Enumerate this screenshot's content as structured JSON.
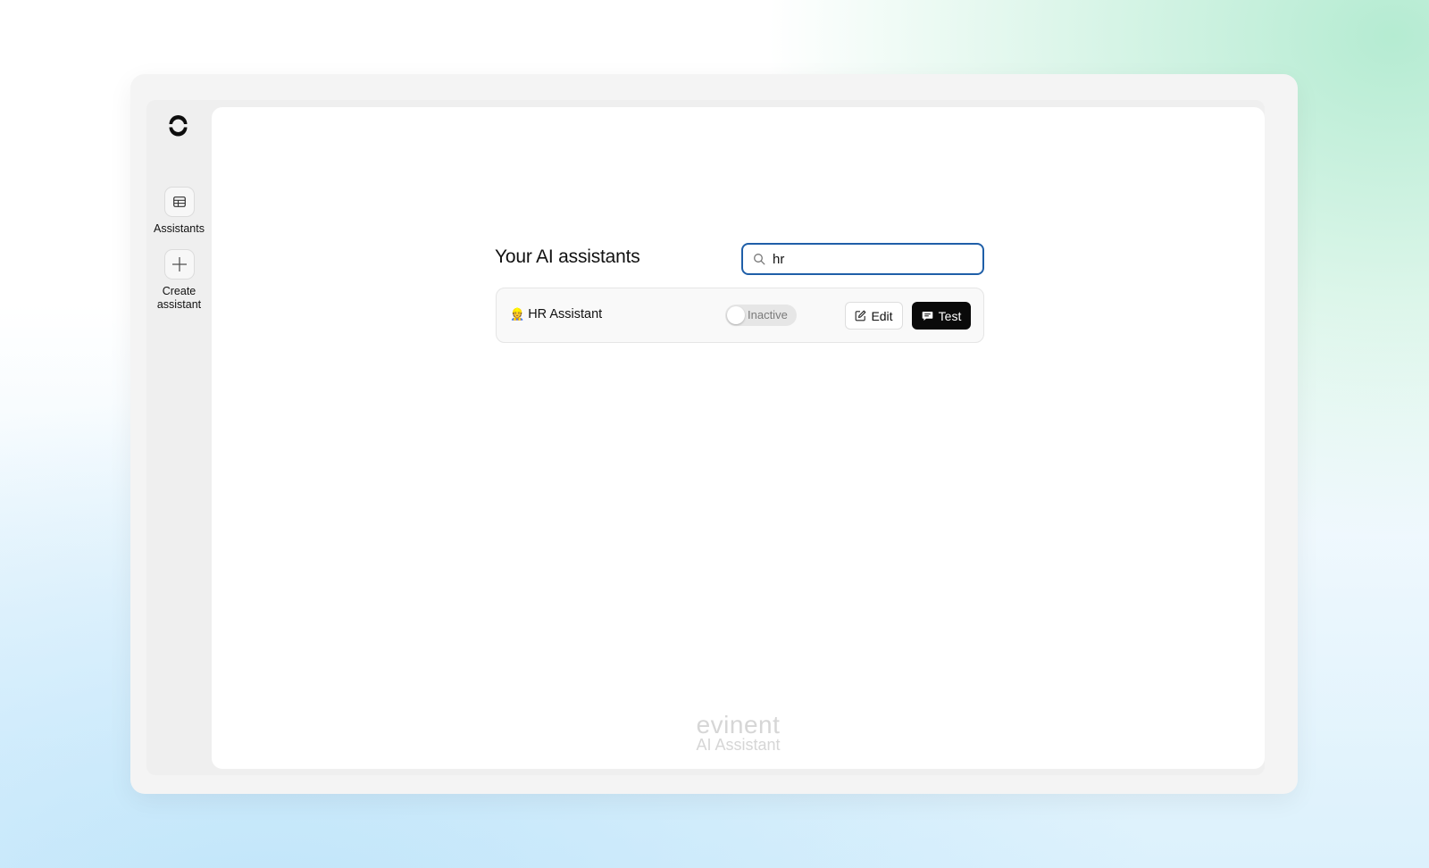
{
  "sidebar": {
    "logo_icon": "evinent-logo-icon",
    "items": [
      {
        "label": "Assistants",
        "icon": "table-icon"
      },
      {
        "label": "Create\nassistant",
        "icon": "plus-icon"
      }
    ]
  },
  "main": {
    "title": "Your AI assistants",
    "search": {
      "value": "hr",
      "placeholder": ""
    },
    "assistants": [
      {
        "emoji": "👷",
        "name": "HR Assistant",
        "status_label": "Inactive",
        "active": false,
        "edit_label": "Edit",
        "test_label": "Test"
      }
    ]
  },
  "footer": {
    "brand_name": "evinent",
    "brand_sub": "AI Assistant"
  },
  "colors": {
    "accent": "#1f5fa8",
    "test_button": "#0a0a0a",
    "toggle_off": "#e6e6e6"
  }
}
